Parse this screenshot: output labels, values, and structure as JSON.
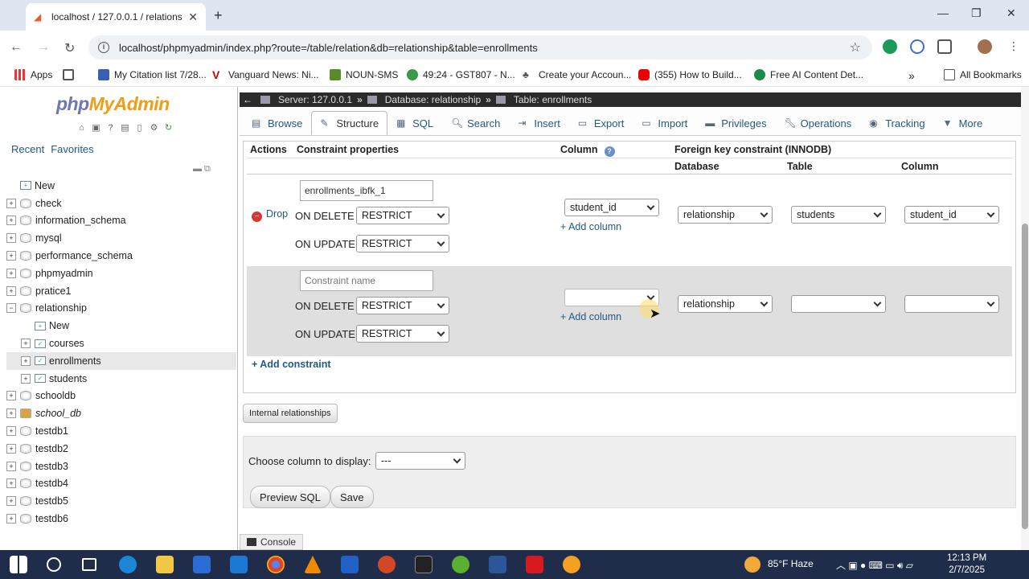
{
  "browser": {
    "tab_title": "localhost / 127.0.0.1 / relations",
    "url": "localhost/phpmyadmin/index.php?route=/table/relation&db=relationship&table=enrollments",
    "bookmarks": [
      "Apps",
      "My Citation list 7/28...",
      "Vanguard News: Ni...",
      "NOUN-SMS",
      "49:24 - GST807 - N...",
      "Create your Accoun...",
      "(355) How to Build...",
      "Free AI Content Det..."
    ],
    "all_bookmarks": "All Bookmarks"
  },
  "nav": {
    "logo_php": "php",
    "logo_myadmin": "MyAdmin",
    "recent": "Recent",
    "favorites": "Favorites",
    "tree": [
      {
        "label": "New",
        "type": "new"
      },
      {
        "label": "check",
        "type": "db"
      },
      {
        "label": "information_schema",
        "type": "db"
      },
      {
        "label": "mysql",
        "type": "db"
      },
      {
        "label": "performance_schema",
        "type": "db"
      },
      {
        "label": "phpmyadmin",
        "type": "db"
      },
      {
        "label": "pratice1",
        "type": "db"
      },
      {
        "label": "relationship",
        "type": "db-open"
      },
      {
        "label": "New",
        "type": "sub-new"
      },
      {
        "label": "courses",
        "type": "table"
      },
      {
        "label": "enrollments",
        "type": "table-active"
      },
      {
        "label": "students",
        "type": "table"
      },
      {
        "label": "schooldb",
        "type": "db"
      },
      {
        "label": "school_db",
        "type": "db-italic"
      },
      {
        "label": "testdb1",
        "type": "db"
      },
      {
        "label": "testdb2",
        "type": "db"
      },
      {
        "label": "testdb3",
        "type": "db"
      },
      {
        "label": "testdb4",
        "type": "db"
      },
      {
        "label": "testdb5",
        "type": "db"
      },
      {
        "label": "testdb6",
        "type": "db"
      }
    ]
  },
  "breadcrumb": {
    "server": "Server: 127.0.0.1",
    "database": "Database: relationship",
    "table": "Table: enrollments"
  },
  "menu": {
    "browse": "Browse",
    "structure": "Structure",
    "sql": "SQL",
    "search": "Search",
    "insert": "Insert",
    "export": "Export",
    "import": "Import",
    "privileges": "Privileges",
    "operations": "Operations",
    "tracking": "Tracking",
    "more": "More"
  },
  "fk": {
    "headers": {
      "actions": "Actions",
      "constraint_properties": "Constraint properties",
      "column": "Column",
      "foreign_key": "Foreign key constraint (INNODB)",
      "database": "Database",
      "table": "Table",
      "ref_column": "Column"
    },
    "row1": {
      "name_value": "enrollments_ibfk_1",
      "drop": "Drop",
      "on_delete_label": "ON DELETE",
      "on_delete": "RESTRICT",
      "on_update_label": "ON UPDATE",
      "on_update": "RESTRICT",
      "column": "student_id",
      "add_column": "+ Add column",
      "database": "relationship",
      "table": "students",
      "ref_column": "student_id"
    },
    "row2": {
      "name_placeholder": "Constraint name",
      "on_delete_label": "ON DELETE",
      "on_delete": "RESTRICT",
      "on_update_label": "ON UPDATE",
      "on_update": "RESTRICT",
      "column": "",
      "add_column": "+ Add column",
      "database": "relationship",
      "table": "",
      "ref_column": ""
    },
    "add_constraint": "+ Add constraint"
  },
  "internal_relationships": "Internal relationships",
  "display": {
    "label": "Choose column to display:",
    "value": "---"
  },
  "buttons": {
    "preview_sql": "Preview SQL",
    "save": "Save"
  },
  "console": "Console",
  "taskbar": {
    "weather": "85°F  Haze",
    "time": "12:13 PM",
    "date": "2/7/2025"
  }
}
